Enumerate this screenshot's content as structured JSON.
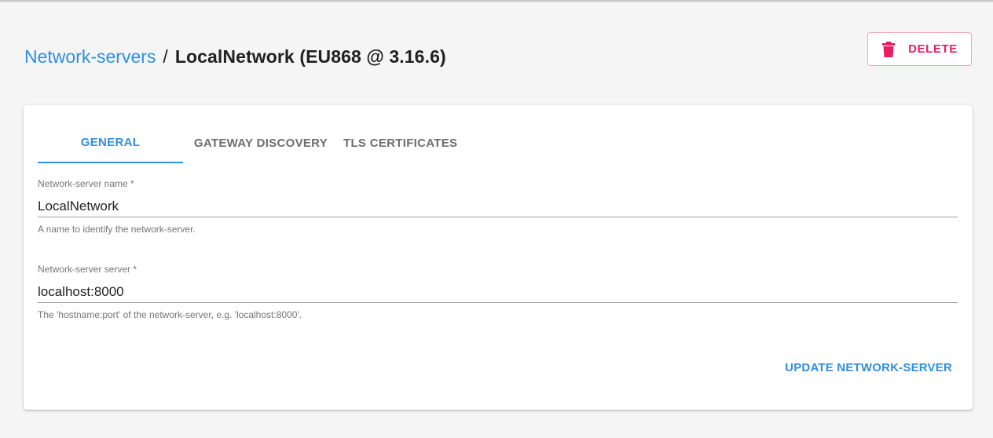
{
  "breadcrumb": {
    "parent": "Network-servers",
    "separator": "/",
    "current": "LocalNetwork (EU868 @ 3.16.6)"
  },
  "actions": {
    "delete_label": "DELETE",
    "delete_icon": "trash-icon"
  },
  "tabs": [
    {
      "label": "GENERAL",
      "active": true
    },
    {
      "label": "GATEWAY DISCOVERY",
      "active": false
    },
    {
      "label": "TLS CERTIFICATES",
      "active": false
    }
  ],
  "form": {
    "name": {
      "label": "Network-server name *",
      "value": "LocalNetwork",
      "help": "A name to identify the network-server."
    },
    "server": {
      "label": "Network-server server *",
      "value": "localhost:8000",
      "help": "The 'hostname:port' of the network-server, e.g. 'localhost:8000'."
    },
    "submit_label": "UPDATE NETWORK-SERVER"
  },
  "colors": {
    "accent": "#2f8fe2",
    "danger": "#e91e63",
    "background": "#f5f5f5"
  }
}
